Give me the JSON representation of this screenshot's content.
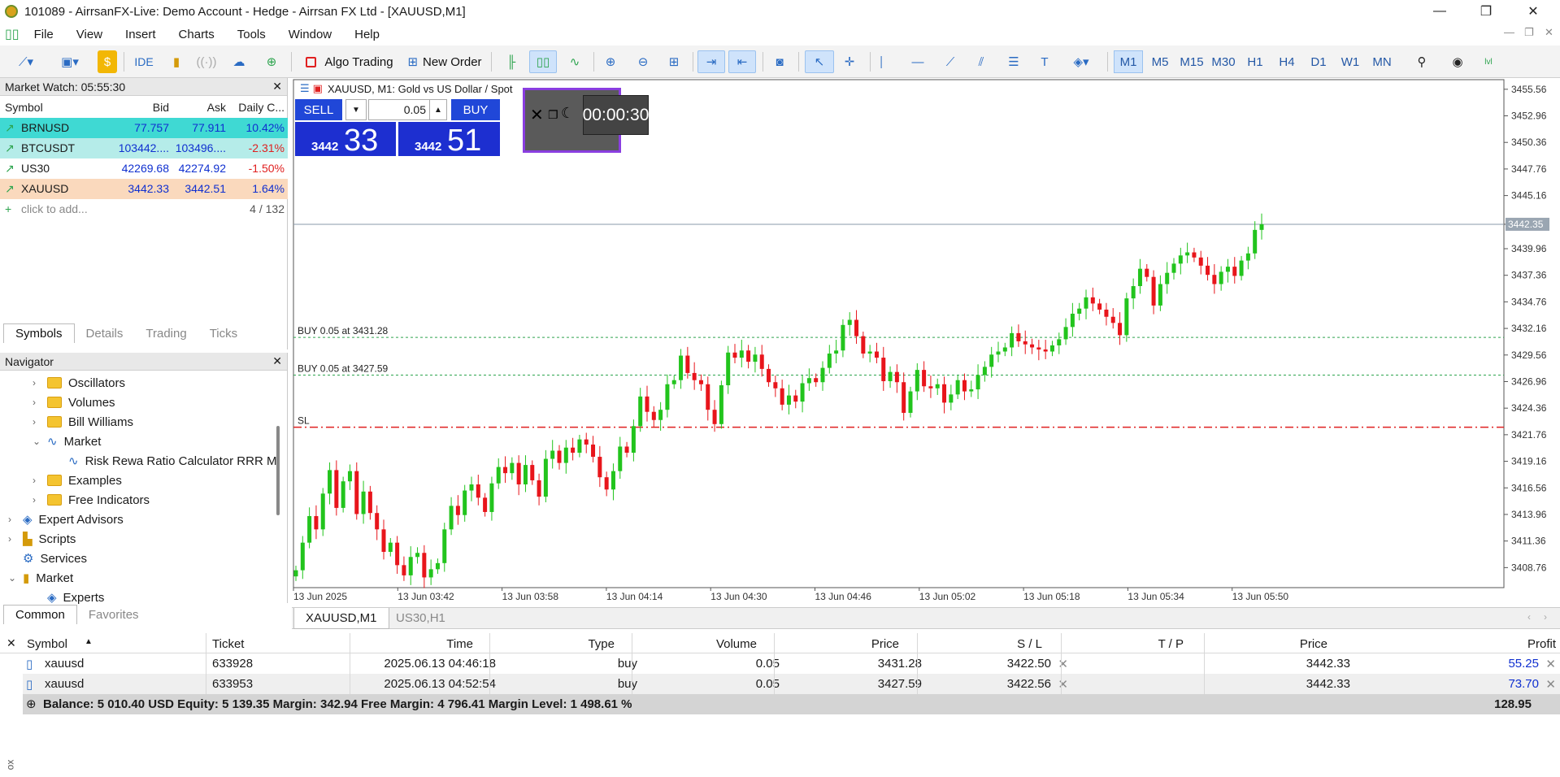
{
  "window": {
    "title": "101089 - AirrsanFX-Live: Demo Account - Hedge - Airrsan FX Ltd - [XAUUSD,M1]",
    "minimize": "—",
    "maximize": "❐",
    "close": "✕"
  },
  "menu": [
    "File",
    "View",
    "Insert",
    "Charts",
    "Tools",
    "Window",
    "Help"
  ],
  "toolbar": {
    "ide": "IDE",
    "algo_trading": "Algo Trading",
    "new_order": "New Order",
    "timeframes": [
      "M1",
      "M5",
      "M15",
      "M30",
      "H1",
      "H4",
      "D1",
      "W1",
      "MN"
    ],
    "active_timeframe": "M1"
  },
  "market_watch": {
    "title": "Market Watch: 05:55:30",
    "columns": [
      "Symbol",
      "Bid",
      "Ask",
      "Daily C..."
    ],
    "rows": [
      {
        "symbol": "BRNUSD",
        "bid": "77.757",
        "ask": "77.911",
        "change": "10.42%",
        "bg": "#3fd9d3"
      },
      {
        "symbol": "BTCUSDT",
        "bid": "103442....",
        "ask": "103496....",
        "change": "-2.31%",
        "bg": "#b5ece9"
      },
      {
        "symbol": "US30",
        "bid": "42269.68",
        "ask": "42274.92",
        "change": "-1.50%",
        "bg": "#ffffff"
      },
      {
        "symbol": "XAUUSD",
        "bid": "3442.33",
        "ask": "3442.51",
        "change": "1.64%",
        "bg": "#fad9bd"
      }
    ],
    "add_text": "click to add...",
    "count": "4 / 132",
    "tabs": [
      "Symbols",
      "Details",
      "Trading",
      "Ticks"
    ]
  },
  "navigator": {
    "title": "Navigator",
    "items": [
      {
        "label": "Oscillators",
        "level": 2,
        "kind": "folder",
        "chev": "›"
      },
      {
        "label": "Volumes",
        "level": 2,
        "kind": "folder",
        "chev": "›"
      },
      {
        "label": "Bill Williams",
        "level": 2,
        "kind": "folder",
        "chev": "›"
      },
      {
        "label": "Market",
        "level": 2,
        "kind": "indicator",
        "chev": "⌄"
      },
      {
        "label": "Risk Rewa Ratio Calculator RRR M",
        "level": 3,
        "kind": "indicator",
        "chev": ""
      },
      {
        "label": "Examples",
        "level": 2,
        "kind": "folder",
        "chev": "›"
      },
      {
        "label": "Free Indicators",
        "level": 2,
        "kind": "folder",
        "chev": "›"
      },
      {
        "label": "Expert Advisors",
        "level": 1,
        "kind": "expert",
        "chev": "›"
      },
      {
        "label": "Scripts",
        "level": 1,
        "kind": "script",
        "chev": "›"
      },
      {
        "label": "Services",
        "level": 1,
        "kind": "service",
        "chev": ""
      },
      {
        "label": "Market",
        "level": 1,
        "kind": "bag",
        "chev": "⌄"
      },
      {
        "label": "Experts",
        "level": 2,
        "kind": "expert",
        "chev": ""
      }
    ],
    "tabs": [
      "Common",
      "Favorites"
    ]
  },
  "chart": {
    "header": "XAUUSD, M1:  Gold vs US Dollar / Spot",
    "sell_label": "SELL",
    "buy_label": "BUY",
    "volume": "0.05",
    "sell_price_small": "3442",
    "sell_price_big": "33",
    "buy_price_small": "3442",
    "buy_price_big": "51",
    "timer": "00:00:30",
    "current_price_label": "3442.35",
    "lines": [
      {
        "label": "BUY 0.05 at 3431.28",
        "price": 3431.28
      },
      {
        "label": "BUY 0.05 at 3427.59",
        "price": 3427.59
      },
      {
        "label": "SL",
        "price": 3422.5
      }
    ],
    "price_ticks": [
      "3455.56",
      "3452.96",
      "3450.36",
      "3447.76",
      "3445.16",
      "3442.35",
      "3439.96",
      "3437.36",
      "3434.76",
      "3432.16",
      "3429.56",
      "3426.96",
      "3424.36",
      "3421.76",
      "3419.16",
      "3416.56",
      "3413.96",
      "3411.36",
      "3408.76"
    ],
    "time_ticks": [
      "13 Jun 2025",
      "13 Jun 03:42",
      "13 Jun 03:58",
      "13 Jun 04:14",
      "13 Jun 04:30",
      "13 Jun 04:46",
      "13 Jun 05:02",
      "13 Jun 05:18",
      "13 Jun 05:34",
      "13 Jun 05:50"
    ],
    "tabs": [
      "XAUUSD,M1",
      "US30,H1"
    ]
  },
  "chart_data": {
    "type": "candlestick",
    "symbol": "XAUUSD",
    "timeframe": "M1",
    "ylim": [
      3406.8,
      3456.5
    ],
    "up_color": "#22c41d",
    "down_color": "#e8151b",
    "current_price": 3442.35,
    "closes": [
      3408.5,
      3411.2,
      3413.8,
      3412.5,
      3416.0,
      3418.3,
      3414.6,
      3417.2,
      3418.2,
      3414.0,
      3416.2,
      3414.1,
      3412.5,
      3410.3,
      3411.2,
      3409.0,
      3408.0,
      3409.8,
      3410.2,
      3407.8,
      3408.6,
      3409.2,
      3412.5,
      3414.8,
      3413.9,
      3416.3,
      3416.9,
      3415.6,
      3414.2,
      3417.0,
      3418.6,
      3418.0,
      3419.0,
      3416.9,
      3418.8,
      3417.3,
      3415.7,
      3419.4,
      3420.2,
      3419.0,
      3420.5,
      3420.0,
      3421.3,
      3420.8,
      3419.6,
      3417.6,
      3416.4,
      3418.2,
      3420.6,
      3420.0,
      3422.6,
      3425.5,
      3424.0,
      3423.2,
      3424.2,
      3426.7,
      3427.1,
      3429.5,
      3427.8,
      3427.1,
      3426.7,
      3424.2,
      3422.8,
      3426.6,
      3429.8,
      3429.3,
      3430.0,
      3428.9,
      3429.6,
      3428.2,
      3426.9,
      3426.3,
      3424.7,
      3425.6,
      3425.0,
      3426.8,
      3427.3,
      3426.9,
      3428.3,
      3429.7,
      3430.0,
      3432.5,
      3433.0,
      3431.4,
      3429.7,
      3429.9,
      3429.3,
      3427.0,
      3427.9,
      3426.9,
      3423.9,
      3426.0,
      3428.1,
      3426.5,
      3426.3,
      3426.7,
      3424.9,
      3425.7,
      3427.1,
      3426.0,
      3426.2,
      3427.6,
      3428.4,
      3429.6,
      3429.9,
      3430.3,
      3431.7,
      3430.9,
      3430.6,
      3430.3,
      3430.1,
      3429.9,
      3430.5,
      3431.1,
      3432.3,
      3433.6,
      3434.1,
      3435.2,
      3434.6,
      3434.0,
      3433.3,
      3432.7,
      3431.5,
      3435.1,
      3436.3,
      3438.0,
      3437.2,
      3434.4,
      3436.5,
      3437.6,
      3438.5,
      3439.3,
      3439.6,
      3439.1,
      3438.3,
      3437.4,
      3436.5,
      3437.7,
      3438.2,
      3437.3,
      3438.8,
      3439.5,
      3441.8,
      3442.35
    ]
  },
  "positions": {
    "columns": [
      "Symbol",
      "Ticket",
      "Time",
      "Type",
      "Volume",
      "Price",
      "S / L",
      "T / P",
      "Price",
      "Profit"
    ],
    "rows": [
      {
        "symbol": "xauusd",
        "ticket": "633928",
        "time": "2025.06.13 04:46:18",
        "type": "buy",
        "volume": "0.05",
        "price": "3431.28",
        "sl": "3422.50",
        "tp": "",
        "current": "3442.33",
        "profit": "55.25"
      },
      {
        "symbol": "xauusd",
        "ticket": "633953",
        "time": "2025.06.13 04:52:54",
        "type": "buy",
        "volume": "0.05",
        "price": "3427.59",
        "sl": "3422.56",
        "tp": "",
        "current": "3442.33",
        "profit": "73.70"
      }
    ],
    "balance_text": "Balance: 5 010.40 USD  Equity: 5 139.35  Margin: 342.94  Free Margin: 4 796.41  Margin Level: 1 498.61 %",
    "total_profit": "128.95",
    "side_label": "ox"
  }
}
